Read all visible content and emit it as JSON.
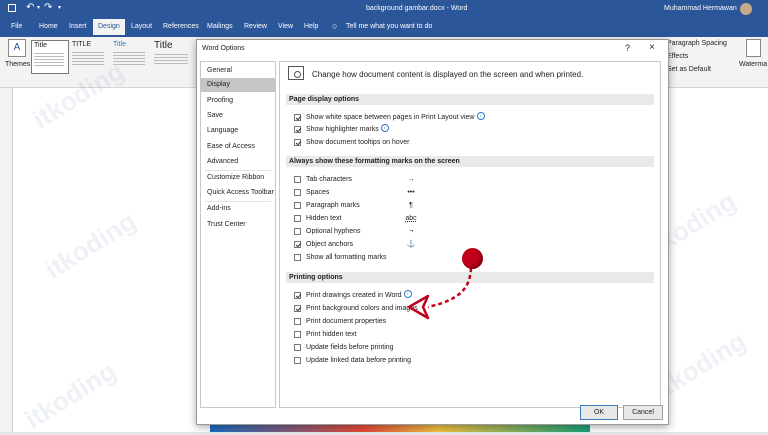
{
  "title_bar": {
    "doc_title": "background gambar.docx - Word",
    "user_name": "Muhammad Hermawan"
  },
  "tabs": [
    "File",
    "Home",
    "Insert",
    "Design",
    "Layout",
    "References",
    "Mailings",
    "Review",
    "View",
    "Help"
  ],
  "tell_me": "Tell me what you want to do",
  "ribbon": {
    "themes_label": "Themes",
    "theme_title": "Title",
    "style_title_caps": "TITLE",
    "style_title_blue": "Title",
    "style_title_big": "Title",
    "paragraph_spacing": "Paragraph Spacing",
    "effects": "Effects",
    "set_as_default": "Set as Default",
    "watermark": "Waterma"
  },
  "watermark_text": "itkoding",
  "dialog": {
    "title": "Word Options",
    "help": "?",
    "close": "×",
    "nav": [
      "General",
      "Display",
      "Proofing",
      "Save",
      "Language",
      "Ease of Access",
      "Advanced",
      "Customize Ribbon",
      "Quick Access Toolbar",
      "Add-ins",
      "Trust Center"
    ],
    "active_nav": "Display",
    "header": "Change how document content is displayed on the screen and when printed.",
    "sections": {
      "page_display": "Page display options",
      "formatting_marks": "Always show these formatting marks on the screen",
      "printing": "Printing options"
    },
    "page_display_options": [
      {
        "label": "Show white space between pages in Print Layout view",
        "checked": true,
        "info": true
      },
      {
        "label": "Show highlighter marks",
        "checked": true,
        "info": true
      },
      {
        "label": "Show document tooltips on hover",
        "checked": true,
        "info": false
      }
    ],
    "formatting_marks": [
      {
        "label": "Tab characters",
        "checked": false,
        "symbol": "→"
      },
      {
        "label": "Spaces",
        "checked": false,
        "symbol": "•••"
      },
      {
        "label": "Paragraph marks",
        "checked": false,
        "symbol": "¶"
      },
      {
        "label": "Hidden text",
        "checked": false,
        "symbol": "abc"
      },
      {
        "label": "Optional hyphens",
        "checked": false,
        "symbol": "¬"
      },
      {
        "label": "Object anchors",
        "checked": true,
        "symbol": "⚓"
      },
      {
        "label": "Show all formatting marks",
        "checked": false,
        "symbol": ""
      }
    ],
    "printing_options": [
      {
        "label": "Print drawings created in Word",
        "checked": true,
        "info": true
      },
      {
        "label": "Print background colors and images",
        "checked": true,
        "info": false
      },
      {
        "label": "Print document properties",
        "checked": false,
        "info": false
      },
      {
        "label": "Print hidden text",
        "checked": false,
        "info": false
      },
      {
        "label": "Update fields before printing",
        "checked": false,
        "info": false
      },
      {
        "label": "Update linked data before printing",
        "checked": false,
        "info": false
      }
    ],
    "ok": "OK",
    "cancel": "Cancel"
  },
  "colors": {
    "word_blue": "#2b579a",
    "annotation_red": "#c0001a"
  }
}
